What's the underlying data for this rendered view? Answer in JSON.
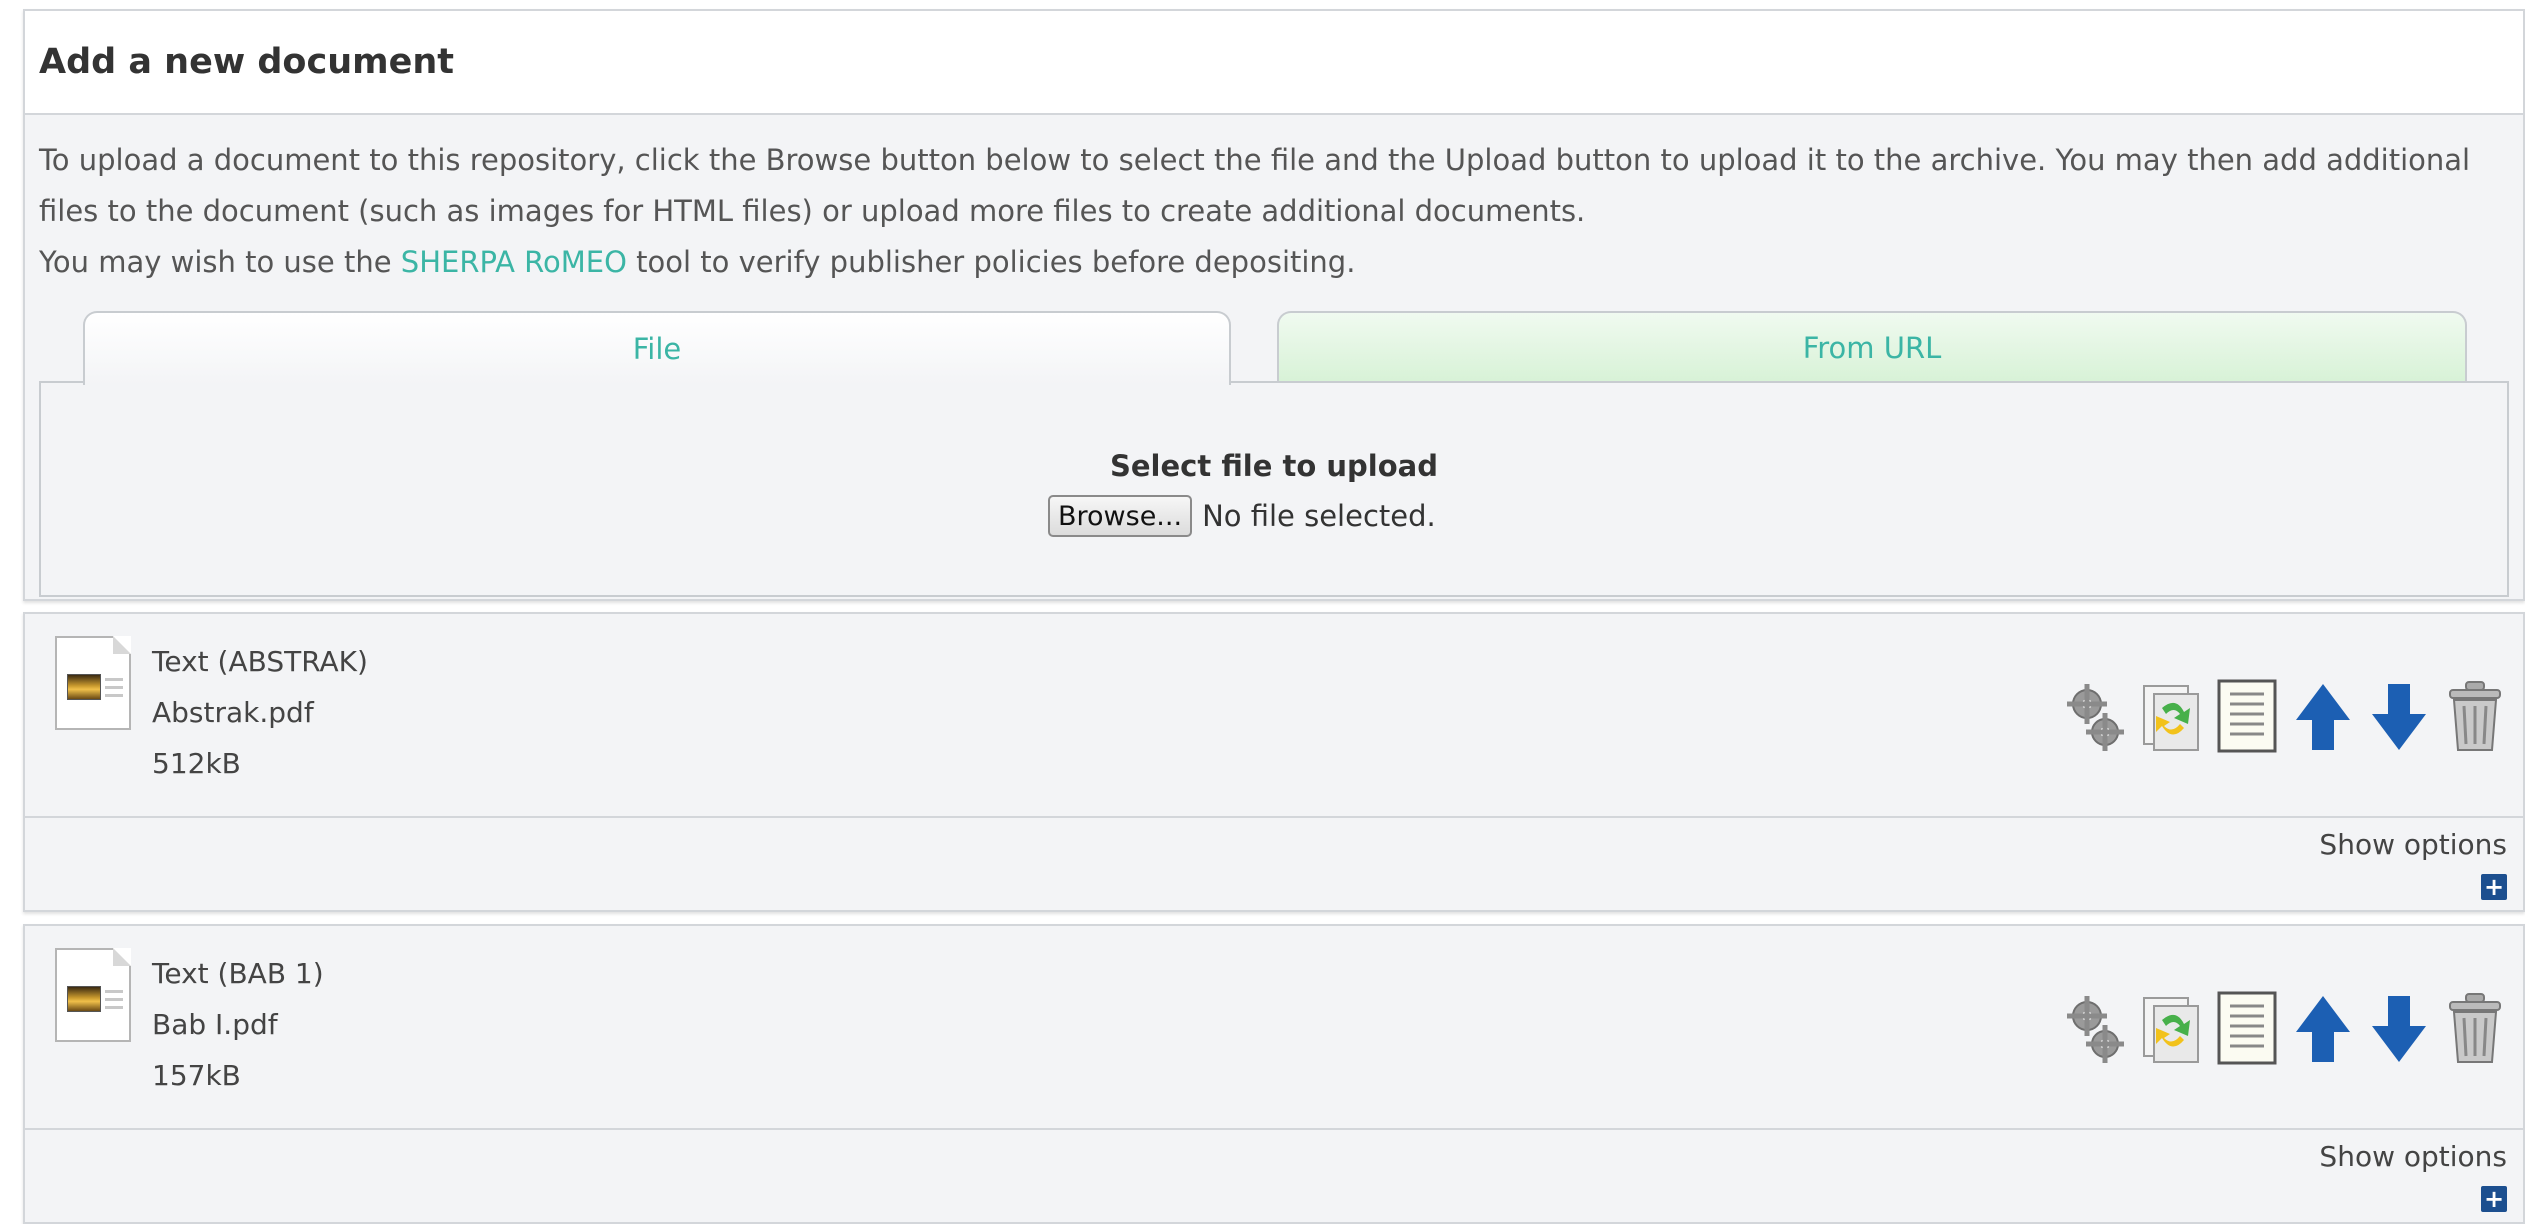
{
  "upload": {
    "title": "Add a new document",
    "intro_line1": "To upload a document to this repository, click the Browse button below to select the file and the Upload button to upload it to the archive. You may then add additional files to the document (such as images for HTML files) or upload more files to create additional documents.",
    "intro_line2_prefix": "You may wish to use the ",
    "intro_link": "SHERPA RoMEO",
    "intro_line2_suffix": " tool to verify publisher policies before depositing.",
    "tabs": [
      {
        "label": "File",
        "active": true
      },
      {
        "label": "From URL",
        "active": false
      }
    ],
    "select_label": "Select file to upload",
    "browse_label": "Browse...",
    "file_status": "No file selected."
  },
  "documents": [
    {
      "type": "Text (ABSTRAK)",
      "filename": "Abstrak.pdf",
      "size": "512kB",
      "show_options": "Show options"
    },
    {
      "type": "Text (BAB 1)",
      "filename": "Bab I.pdf",
      "size": "157kB",
      "show_options": "Show options"
    }
  ],
  "icons": {
    "settings": "gears-icon",
    "convert": "convert-document-icon",
    "view": "document-details-icon",
    "move_up": "arrow-up-icon",
    "move_down": "arrow-down-icon",
    "delete": "trash-icon",
    "expand": "plus-icon"
  },
  "colors": {
    "link": "#3bb5a5",
    "arrow": "#1c5fb3",
    "tab_url_bg": "#d7f2d6"
  }
}
